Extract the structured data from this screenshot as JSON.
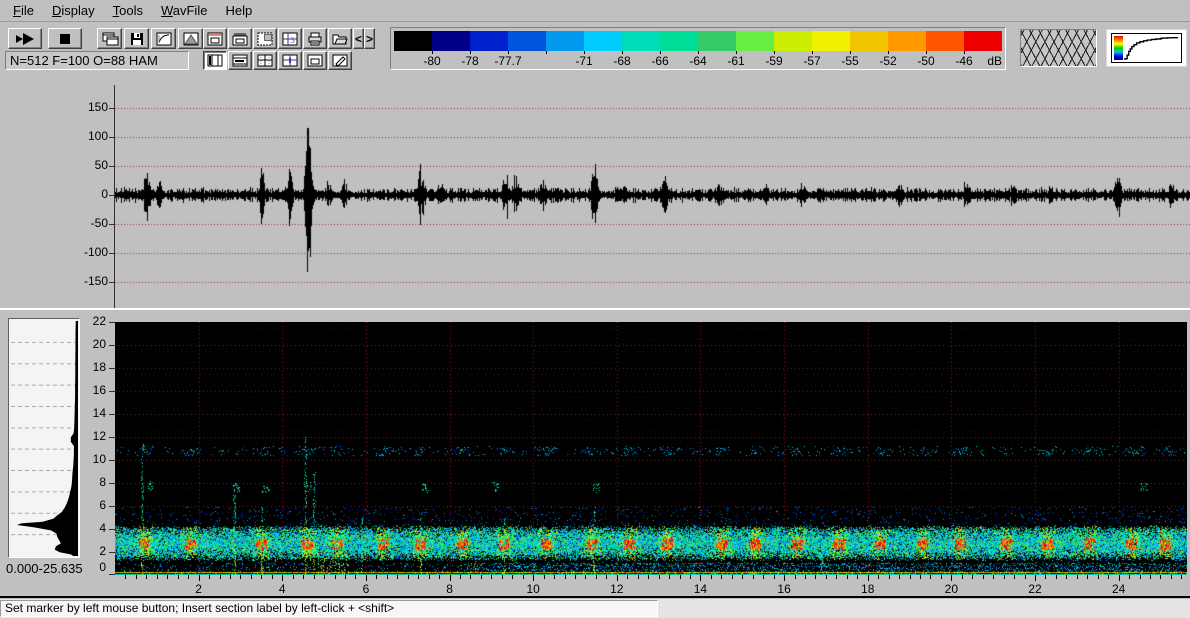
{
  "menu": {
    "items": [
      {
        "u": "F",
        "rest": "ile"
      },
      {
        "u": "D",
        "rest": "isplay"
      },
      {
        "u": "T",
        "rest": "ools"
      },
      {
        "u": "W",
        "rest": "avFile"
      },
      {
        "label": "Help"
      }
    ]
  },
  "toolbar": {
    "status_text": "N=512 F=100 O=88 HAM",
    "prev_glyph": "<",
    "next_glyph": ">",
    "buttons_row1": [
      "play",
      "stop",
      "cascade-windows",
      "save",
      "transfer-curve",
      "peak-window",
      "display-window",
      "comb-window",
      "selection-window",
      "scale-grid",
      "print",
      "open-file",
      "prev",
      "next"
    ],
    "buttons_row2": [
      "layout-vertical-bars",
      "layout-horizontal-lines",
      "layout-grid-cross",
      "layout-grid-plus",
      "layout-inner-window",
      "edit-labels"
    ]
  },
  "color_scale": {
    "unit": "dB",
    "colors": [
      "#000000",
      "#000088",
      "#0022cc",
      "#0055dd",
      "#0099ee",
      "#00ccff",
      "#00ddbb",
      "#00dd99",
      "#33cc66",
      "#66ee44",
      "#ccee00",
      "#f2f200",
      "#f2c400",
      "#ff9900",
      "#ff5500",
      "#ee0000"
    ],
    "labels": [
      {
        "text": "-80",
        "pos": 1
      },
      {
        "text": "-78",
        "pos": 2
      },
      {
        "text": "-77.7",
        "pos": 3
      },
      {
        "text": "-71",
        "pos": 5
      },
      {
        "text": "-68",
        "pos": 6
      },
      {
        "text": "-66",
        "pos": 7
      },
      {
        "text": "-64",
        "pos": 8
      },
      {
        "text": "-61",
        "pos": 9
      },
      {
        "text": "-59",
        "pos": 10
      },
      {
        "text": "-57",
        "pos": 11
      },
      {
        "text": "-55",
        "pos": 12
      },
      {
        "text": "-52",
        "pos": 13
      },
      {
        "text": "-50",
        "pos": 14
      },
      {
        "text": "-46",
        "pos": 15
      }
    ]
  },
  "profile_panel": {
    "range_label": "0.000-25.635",
    "points": [
      [
        0,
        0.06
      ],
      [
        0.15,
        0.1
      ],
      [
        0.35,
        0.28
      ],
      [
        0.6,
        0.36
      ],
      [
        0.9,
        0.34
      ],
      [
        1.2,
        0.26
      ],
      [
        1.5,
        0.29
      ],
      [
        1.8,
        0.32
      ],
      [
        2.1,
        0.33
      ],
      [
        2.4,
        0.42
      ],
      [
        2.7,
        0.7
      ],
      [
        2.9,
        0.97
      ],
      [
        3.05,
        0.9
      ],
      [
        3.2,
        0.55
      ],
      [
        3.5,
        0.38
      ],
      [
        3.8,
        0.32
      ],
      [
        4.1,
        0.25
      ],
      [
        4.5,
        0.2
      ],
      [
        5,
        0.16
      ],
      [
        5.5,
        0.13
      ],
      [
        6,
        0.11
      ],
      [
        6.5,
        0.09
      ],
      [
        7,
        0.08
      ],
      [
        7.7,
        0.075
      ],
      [
        8.5,
        0.06
      ],
      [
        9.5,
        0.05
      ],
      [
        10.3,
        0.05
      ],
      [
        10.7,
        0.1
      ],
      [
        11.1,
        0.1
      ],
      [
        11.5,
        0.055
      ],
      [
        12,
        0.045
      ],
      [
        13,
        0.04
      ],
      [
        14,
        0.035
      ],
      [
        15,
        0.03
      ],
      [
        16,
        0.03
      ],
      [
        17,
        0.028
      ],
      [
        18,
        0.028
      ],
      [
        19,
        0.026
      ],
      [
        20,
        0.025
      ],
      [
        21,
        0.025
      ],
      [
        22,
        0.02
      ]
    ]
  },
  "transfer_panel": {
    "curve": [
      [
        0,
        1
      ],
      [
        0.04,
        0.95
      ],
      [
        0.07,
        0.8
      ],
      [
        0.1,
        0.64
      ],
      [
        0.13,
        0.54
      ],
      [
        0.17,
        0.44
      ],
      [
        0.22,
        0.36
      ],
      [
        0.28,
        0.29
      ],
      [
        0.35,
        0.24
      ],
      [
        0.42,
        0.2
      ],
      [
        0.5,
        0.17
      ],
      [
        0.58,
        0.145
      ],
      [
        0.68,
        0.125
      ],
      [
        0.72,
        0.09
      ],
      [
        0.8,
        0.085
      ],
      [
        0.9,
        0.075
      ],
      [
        1,
        0.07
      ]
    ]
  },
  "status_bar": {
    "message": "Set marker by left mouse button; Insert section label by left-click + <shift>"
  },
  "chart_data": [
    {
      "type": "line",
      "title": "waveform",
      "x_range": [
        0,
        25.635
      ],
      "ylim": [
        -190,
        190
      ],
      "y_ticks": [
        150,
        100,
        50,
        0,
        -50,
        -100,
        -150
      ],
      "grid": "dotted-horizontal",
      "noise_amplitude": 8,
      "events": [
        {
          "t": 0.75,
          "a": 45
        },
        {
          "t": 1.05,
          "a": 30
        },
        {
          "t": 3.5,
          "a": 55
        },
        {
          "t": 4.15,
          "a": 58
        },
        {
          "t": 4.62,
          "a": 185
        },
        {
          "t": 5.1,
          "a": 30
        },
        {
          "t": 5.45,
          "a": 35
        },
        {
          "t": 7.3,
          "a": 60
        },
        {
          "t": 7.75,
          "a": 28
        },
        {
          "t": 9.3,
          "a": 65
        },
        {
          "t": 9.55,
          "a": 40
        },
        {
          "t": 10.2,
          "a": 35
        },
        {
          "t": 11.42,
          "a": 78
        },
        {
          "t": 12.1,
          "a": 25
        },
        {
          "t": 13.1,
          "a": 45
        },
        {
          "t": 14.4,
          "a": 25
        },
        {
          "t": 15.5,
          "a": 22
        },
        {
          "t": 16.4,
          "a": 28
        },
        {
          "t": 17.6,
          "a": 22
        },
        {
          "t": 18.7,
          "a": 25
        },
        {
          "t": 20.3,
          "a": 35
        },
        {
          "t": 21.4,
          "a": 25
        },
        {
          "t": 22.3,
          "a": 22
        },
        {
          "t": 23.9,
          "a": 50
        },
        {
          "t": 25.2,
          "a": 35
        }
      ]
    },
    {
      "type": "heatmap",
      "title": "spectrogram",
      "x_range": [
        0,
        25.635
      ],
      "y_range": [
        0,
        22
      ],
      "x_ticks": [
        2,
        4,
        6,
        8,
        10,
        12,
        14,
        16,
        18,
        20,
        22,
        24
      ],
      "y_ticks": [
        22,
        20,
        18,
        16,
        14,
        12,
        10,
        8,
        6,
        4,
        2,
        0
      ],
      "grid": "dotted-red",
      "main_band_khz": [
        1.25,
        4.35
      ],
      "bottom_line_khz": 0.3,
      "speckle_row_khz": [
        10.4,
        11.2
      ],
      "hotspot_times": [
        0.7,
        1.8,
        3.5,
        4.6,
        5.3,
        6.4,
        7.3,
        8.3,
        9.3,
        10.3,
        11.4,
        12.3,
        13.2,
        14.5,
        15.3,
        16.3,
        17.3,
        18.3,
        19.3,
        20.2,
        21.3,
        22.3,
        23.3,
        24.3,
        25.1
      ],
      "streaks": [
        {
          "t": 0.65,
          "h": 11.5
        },
        {
          "t": 2.85,
          "h": 8
        },
        {
          "t": 3.5,
          "h": 6
        },
        {
          "t": 4.55,
          "h": 12
        },
        {
          "t": 4.75,
          "h": 9
        },
        {
          "t": 5.9,
          "h": 5
        },
        {
          "t": 7.3,
          "h": 5
        },
        {
          "t": 8.6,
          "h": 4
        },
        {
          "t": 9.3,
          "h": 5
        },
        {
          "t": 11.45,
          "h": 6
        },
        {
          "t": 16.9,
          "h": 3
        }
      ],
      "comb": {
        "t0": 4.85,
        "t1": 5.6,
        "h": 4.4
      },
      "mid_blobs": [
        {
          "t": 0.85,
          "f": 7.8
        },
        {
          "t": 2.9,
          "f": 7.6
        },
        {
          "t": 3.6,
          "f": 7.5
        },
        {
          "t": 4.6,
          "f": 7.7
        },
        {
          "t": 7.4,
          "f": 7.6
        },
        {
          "t": 9.1,
          "f": 7.7
        },
        {
          "t": 11.5,
          "f": 7.6
        },
        {
          "t": 24.6,
          "f": 7.7
        }
      ],
      "bottom_wash_from": 8.4
    }
  ]
}
